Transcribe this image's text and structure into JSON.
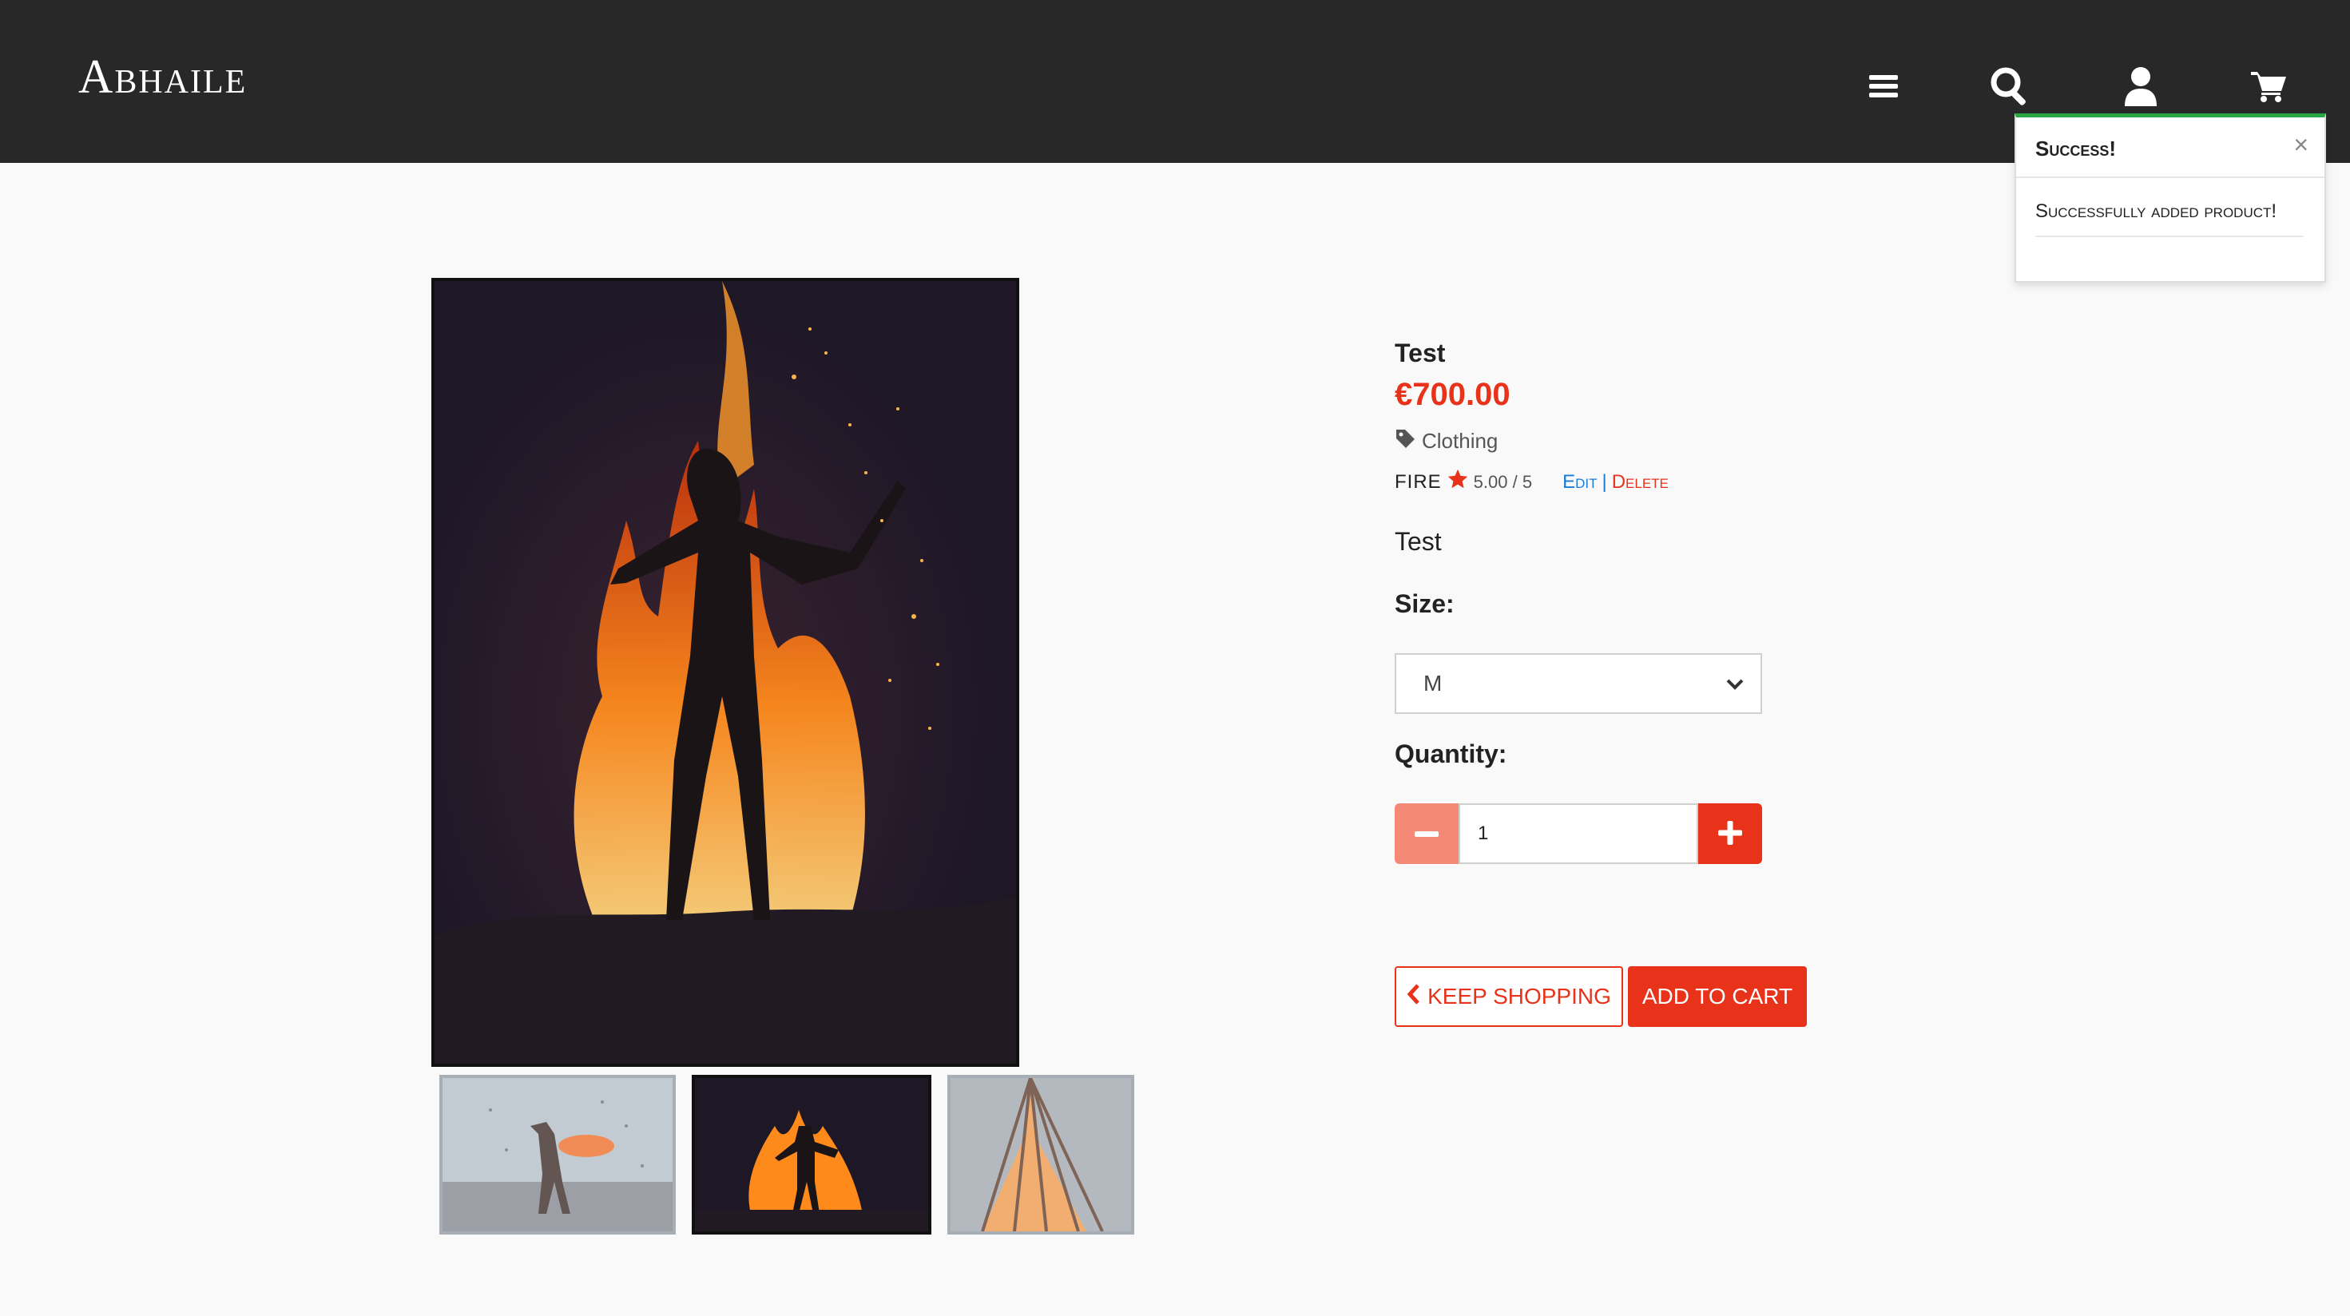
{
  "header": {
    "brand": "Abhaile",
    "icons": [
      "menu-icon",
      "search-icon",
      "user-icon",
      "cart-icon"
    ]
  },
  "toast": {
    "title": "Success!",
    "close": "×",
    "message": "Successfully added product!"
  },
  "gallery": {
    "main_image": "fire-silhouette-image",
    "thumbnails": [
      "fire-person-mist-thumbnail",
      "fire-silhouette-thumbnail",
      "bonfire-thumbnail"
    ],
    "selected_index": 1
  },
  "product": {
    "name": "Test",
    "price": "€700.00",
    "category": "Clothing",
    "brand": "FIRE",
    "rating": "5.00 / 5",
    "edit": "Edit",
    "separator": "|",
    "delete": "Delete",
    "description": "Test"
  },
  "size": {
    "label": "Size:",
    "selected": "M"
  },
  "quantity": {
    "label": "Quantity:",
    "value": "1"
  },
  "actions": {
    "keep_shopping": "KEEP SHOPPING",
    "add_to_cart": "ADD TO CART"
  },
  "colors": {
    "header_bg": "#282828",
    "accent": "#e8321a",
    "accent_light": "#f58978",
    "link_blue": "#1a7bd6",
    "success_green": "#28a745",
    "page_bg": "#f9f9f9"
  }
}
